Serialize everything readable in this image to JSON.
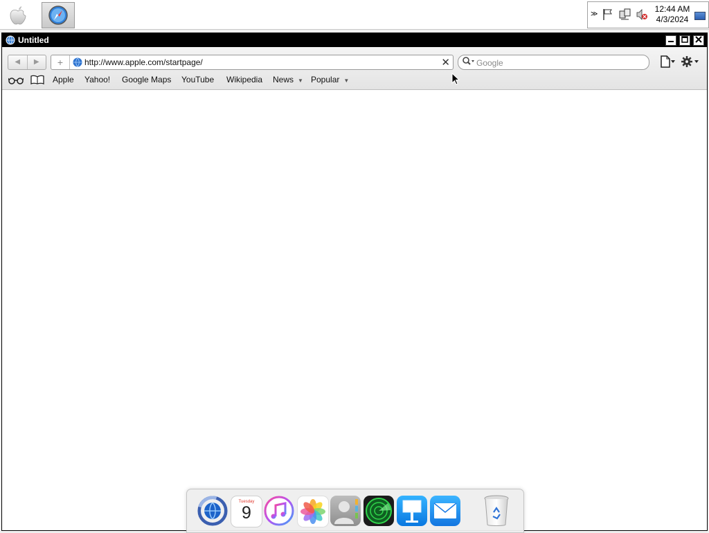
{
  "taskbar": {
    "clock_time": "12:44 AM",
    "clock_date": "4/3/2024",
    "tray_icons": [
      "chevron-icon",
      "flag-icon",
      "network-icon",
      "speaker-muted-icon",
      "desktop-icon"
    ]
  },
  "window": {
    "title": "Untitled",
    "controls": [
      "minimize",
      "maximize",
      "close"
    ]
  },
  "toolbar": {
    "back": "◀",
    "forward": "▶",
    "add": "+",
    "url": "http://www.apple.com/startpage/",
    "clear": "✕",
    "search_placeholder": "Google"
  },
  "bookmarks": {
    "items": [
      {
        "label": "Apple",
        "menu": false
      },
      {
        "label": "Yahoo!",
        "menu": false
      },
      {
        "label": "Google Maps",
        "menu": false
      },
      {
        "label": "YouTube",
        "menu": false
      },
      {
        "label": "Wikipedia",
        "menu": false
      },
      {
        "label": "News",
        "menu": true
      },
      {
        "label": "Popular",
        "menu": true
      }
    ],
    "menu_arrow": "▼"
  },
  "dock": {
    "calendar_day": "Tuesday",
    "calendar_date": "9",
    "apps": [
      "finder",
      "calendar",
      "itunes",
      "photos",
      "contacts",
      "find-my-iphone",
      "keynote",
      "mail",
      "trash"
    ]
  },
  "colors": {
    "titlebar": "#000000",
    "dock_bg": "#eeeeee",
    "accent": "#1e88e5"
  }
}
